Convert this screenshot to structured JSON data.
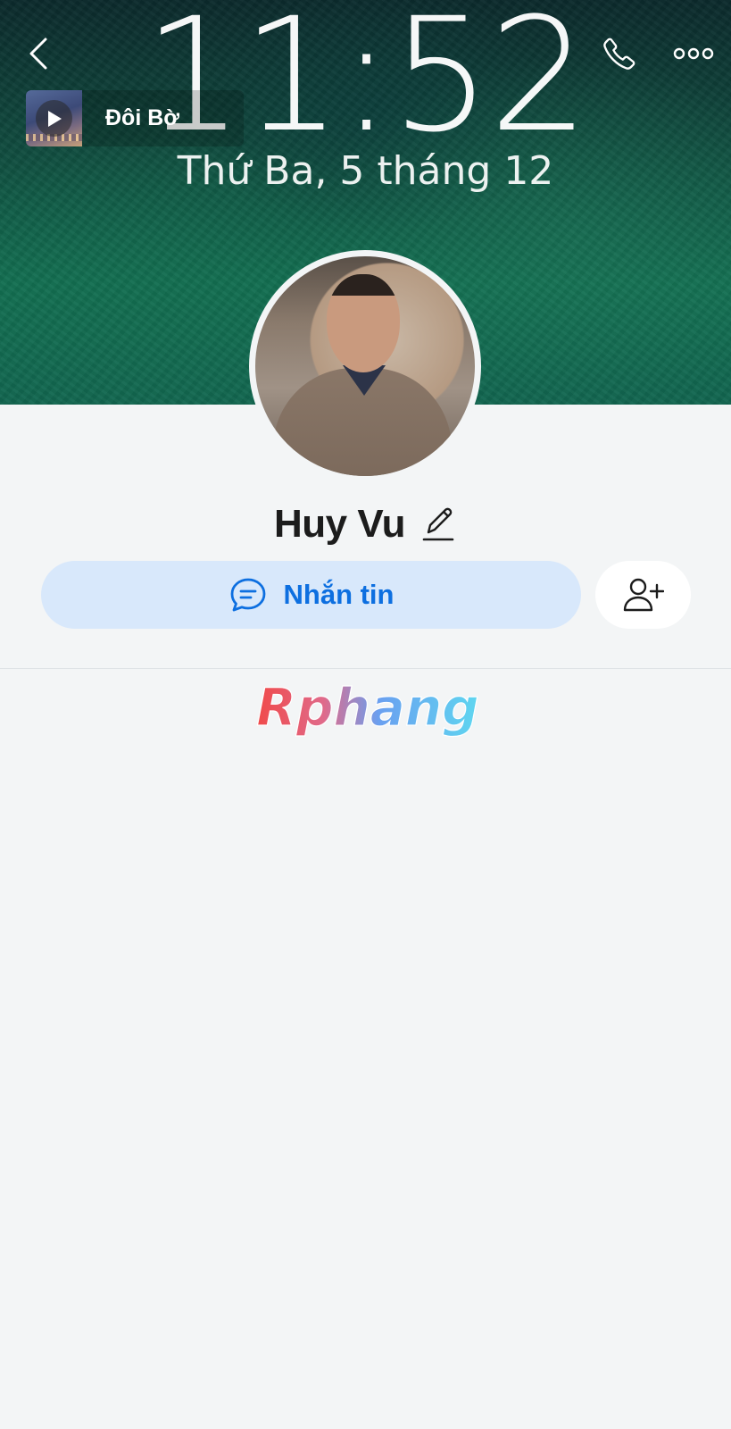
{
  "cover": {
    "time": "11:52",
    "date": "Thứ Ba, 5 tháng 12"
  },
  "header": {
    "back_icon": "chevron-left-icon",
    "call_icon": "phone-icon",
    "more_icon": "more-dots-icon"
  },
  "music": {
    "title": "Đôi Bờ",
    "play_icon": "play-icon"
  },
  "profile": {
    "name": "Huy Vu",
    "edit_icon": "pencil-icon"
  },
  "actions": {
    "message_label": "Nhắn tin",
    "message_icon": "chat-bubble-icon",
    "add_friend_icon": "add-user-icon"
  },
  "watermark": {
    "text": "Rphang"
  },
  "colors": {
    "accent": "#0d6fe0",
    "message_button_bg": "#d8e8fb",
    "page_bg": "#f3f5f6"
  }
}
